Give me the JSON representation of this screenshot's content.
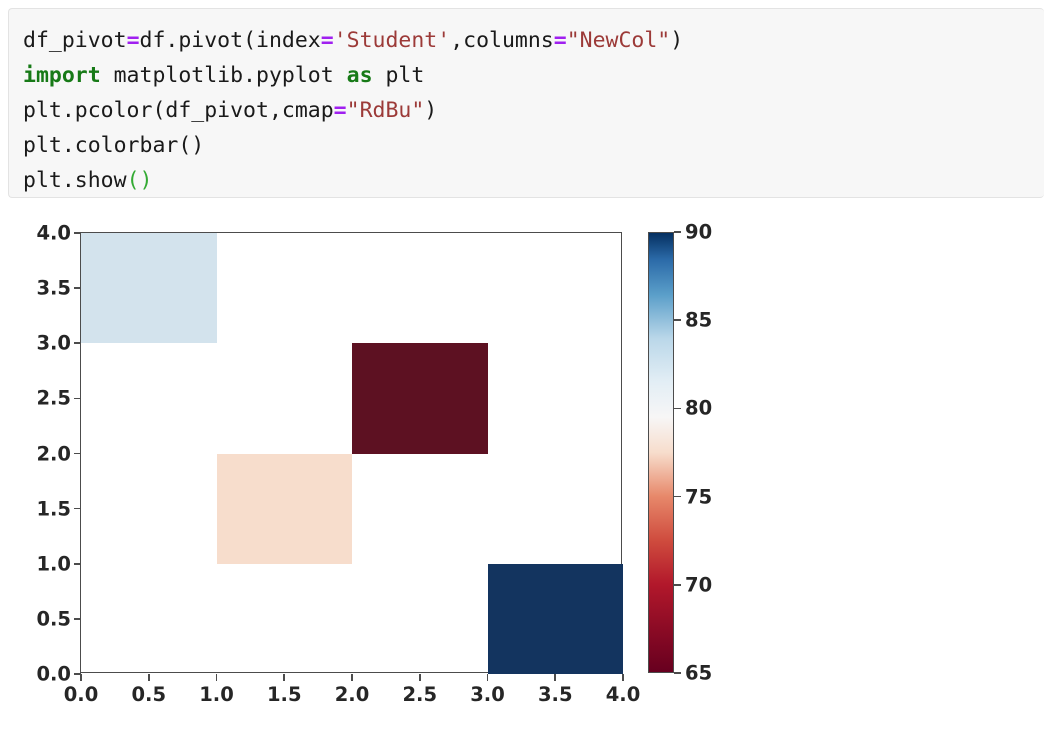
{
  "code_cell": {
    "language": "python",
    "background": "#f7f7f7",
    "lines": [
      [
        {
          "t": "df_pivot",
          "c": "plain"
        },
        {
          "t": "=",
          "c": "op"
        },
        {
          "t": "df.pivot(index",
          "c": "plain"
        },
        {
          "t": "=",
          "c": "op"
        },
        {
          "t": "'Student'",
          "c": "str"
        },
        {
          "t": ",columns",
          "c": "plain"
        },
        {
          "t": "=",
          "c": "op"
        },
        {
          "t": "\"NewCol\"",
          "c": "str"
        },
        {
          "t": ")",
          "c": "plain"
        }
      ],
      [
        {
          "t": "import",
          "c": "kw"
        },
        {
          "t": " matplotlib.pyplot ",
          "c": "plain"
        },
        {
          "t": "as",
          "c": "kw"
        },
        {
          "t": " plt",
          "c": "plain"
        }
      ],
      [
        {
          "t": "plt.pcolor(df_pivot,cmap",
          "c": "plain"
        },
        {
          "t": "=",
          "c": "op"
        },
        {
          "t": "\"RdBu\"",
          "c": "str"
        },
        {
          "t": ")",
          "c": "plain"
        }
      ],
      [
        {
          "t": "plt.colorbar()",
          "c": "plain"
        }
      ],
      [
        {
          "t": "plt.show",
          "c": "plain"
        },
        {
          "t": "()",
          "c": "paren-g"
        }
      ]
    ],
    "plain_text": "df_pivot=df.pivot(index='Student',columns=\"NewCol\")\nimport matplotlib.pyplot as plt\nplt.pcolor(df_pivot,cmap=\"RdBu\")\nplt.colorbar()\nplt.show()"
  },
  "chart_data": {
    "type": "heatmap",
    "title": "",
    "xlabel": "",
    "ylabel": "",
    "xlim": [
      0.0,
      4.0
    ],
    "ylim": [
      0.0,
      4.0
    ],
    "xticks": [
      "0.0",
      "0.5",
      "1.0",
      "1.5",
      "2.0",
      "2.5",
      "3.0",
      "3.5",
      "4.0"
    ],
    "xtick_values": [
      0.0,
      0.5,
      1.0,
      1.5,
      2.0,
      2.5,
      3.0,
      3.5,
      4.0
    ],
    "yticks": [
      "0.0",
      "0.5",
      "1.0",
      "1.5",
      "2.0",
      "2.5",
      "3.0",
      "3.5",
      "4.0"
    ],
    "ytick_values": [
      0.0,
      0.5,
      1.0,
      1.5,
      2.0,
      2.5,
      3.0,
      3.5,
      4.0
    ],
    "grid": false,
    "colormap": "RdBu",
    "nan_color": "#ffffff",
    "cells": [
      {
        "label": "cell-col0-row3",
        "col": 0,
        "row": 3,
        "value": 85,
        "color": "#d3e3ed"
      },
      {
        "label": "cell-col1-row1",
        "col": 1,
        "row": 1,
        "value": 74,
        "color": "#f7ddcc"
      },
      {
        "label": "cell-col2-row2",
        "col": 2,
        "row": 2,
        "value": 66,
        "color": "#5d1122"
      },
      {
        "label": "cell-col3-row0",
        "col": 3,
        "row": 0,
        "value": 90,
        "color": "#13345f"
      }
    ],
    "matrix": [
      [
        null,
        null,
        null,
        90
      ],
      [
        null,
        74,
        null,
        null
      ],
      [
        null,
        null,
        66,
        null
      ],
      [
        85,
        null,
        null,
        null
      ]
    ],
    "colorbar": {
      "vmin": 65,
      "vmax": 90,
      "ticks": [
        "65",
        "70",
        "75",
        "80",
        "85",
        "90"
      ],
      "tick_values": [
        65,
        70,
        75,
        80,
        85,
        90
      ],
      "orientation": "vertical",
      "position": "right",
      "gradient_stops": [
        {
          "pos": 0,
          "color": "#67001f"
        },
        {
          "pos": 10,
          "color": "#8c0b25"
        },
        {
          "pos": 20,
          "color": "#b2182b"
        },
        {
          "pos": 30,
          "color": "#cf4c3e"
        },
        {
          "pos": 40,
          "color": "#e7886a"
        },
        {
          "pos": 50,
          "color": "#f7ddcc"
        },
        {
          "pos": 58,
          "color": "#f7f6f6"
        },
        {
          "pos": 66,
          "color": "#e3eef5"
        },
        {
          "pos": 76,
          "color": "#bad7e9"
        },
        {
          "pos": 86,
          "color": "#5a9ec9"
        },
        {
          "pos": 94,
          "color": "#2b6aa8"
        },
        {
          "pos": 100,
          "color": "#053061"
        }
      ]
    },
    "axis_color": "#4c4c4c"
  }
}
